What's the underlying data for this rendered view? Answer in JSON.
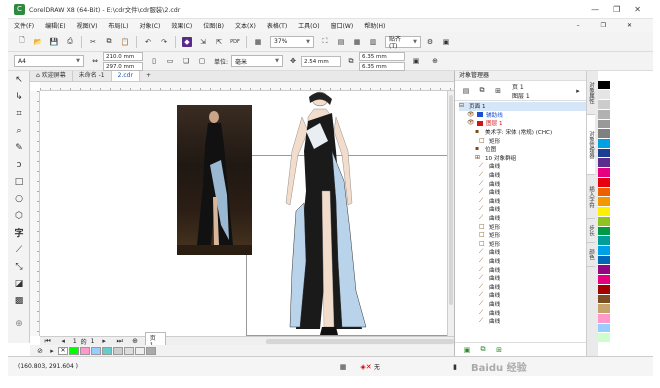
{
  "window": {
    "title": "CorelDRAW X8 (64-Bit) - E:\\cdr文件\\cdr服装\\2.cdr"
  },
  "menu": [
    "文件(F)",
    "编辑(E)",
    "视图(V)",
    "布局(L)",
    "对象(C)",
    "效果(C)",
    "位图(B)",
    "文本(X)",
    "表格(T)",
    "工具(O)",
    "窗口(W)",
    "帮助(H)"
  ],
  "toolbar": {
    "zoom": "37%",
    "snap": "贴齐(T)"
  },
  "propbar": {
    "page_size": "A4",
    "width": "210.0 mm",
    "height": "297.0 mm",
    "units_label": "单位:",
    "units": "毫米",
    "nudge": "2.54 mm",
    "dup_x": "6.35 mm",
    "dup_y": "6.35 mm"
  },
  "tabs": [
    "欢迎屏幕",
    "未命名 -1",
    "2.cdr"
  ],
  "page_nav": {
    "current": "1",
    "sep": "的",
    "total": "1",
    "page_label": "页 1"
  },
  "status": {
    "coords": "(160.803, 291.604 )",
    "fill": "无"
  },
  "docker": {
    "title": "对象管理器",
    "page_header": "页 1",
    "layer_header": "图层 1",
    "tree": [
      {
        "label": "页面 1",
        "selected": true
      },
      {
        "label": "辅助线",
        "color": "#1c4fcf"
      },
      {
        "label": "图层 1",
        "color": "#d21414"
      },
      {
        "label": "美术字: 宋体 (常规) (CHC)"
      },
      {
        "label": "矩形"
      },
      {
        "label": "位图"
      },
      {
        "label": "10 对象群组"
      },
      {
        "label": "曲线"
      },
      {
        "label": "曲线"
      },
      {
        "label": "曲线"
      },
      {
        "label": "曲线"
      },
      {
        "label": "曲线"
      },
      {
        "label": "曲线"
      },
      {
        "label": "曲线"
      },
      {
        "label": "矩形"
      },
      {
        "label": "矩形"
      },
      {
        "label": "矩形"
      },
      {
        "label": "曲线"
      },
      {
        "label": "曲线"
      },
      {
        "label": "曲线"
      },
      {
        "label": "曲线"
      },
      {
        "label": "曲线"
      },
      {
        "label": "曲线"
      },
      {
        "label": "曲线"
      },
      {
        "label": "曲线"
      },
      {
        "label": "曲线"
      }
    ],
    "side_tabs": [
      "对象属性",
      "对象管理器",
      "插入字符",
      "步长",
      "颜色"
    ]
  },
  "colors": {
    "palette": [
      "#ffffff",
      "#000000",
      "#e5e5e5",
      "#cccccc",
      "#b2b2b2",
      "#999999",
      "#808080",
      "#00a1e4",
      "#1c3f94",
      "#5b2d8e",
      "#e4007f",
      "#e60012",
      "#eb6100",
      "#f39800",
      "#fff100",
      "#8fc31f",
      "#009944",
      "#009e96",
      "#00a0e9",
      "#0068b7",
      "#920783",
      "#e4007f",
      "#a40000",
      "#7d4e24",
      "#c5a46d",
      "#ff99cc",
      "#99ccff",
      "#ccffcc"
    ],
    "bottom_swatches": [
      "#00ff00",
      "#ff99cc",
      "#99ccff",
      "#66cccc",
      "#cccccc",
      "#dddddd",
      "#eeeeee",
      "#aaaaaa"
    ]
  },
  "watermark": "Baidu 经验"
}
